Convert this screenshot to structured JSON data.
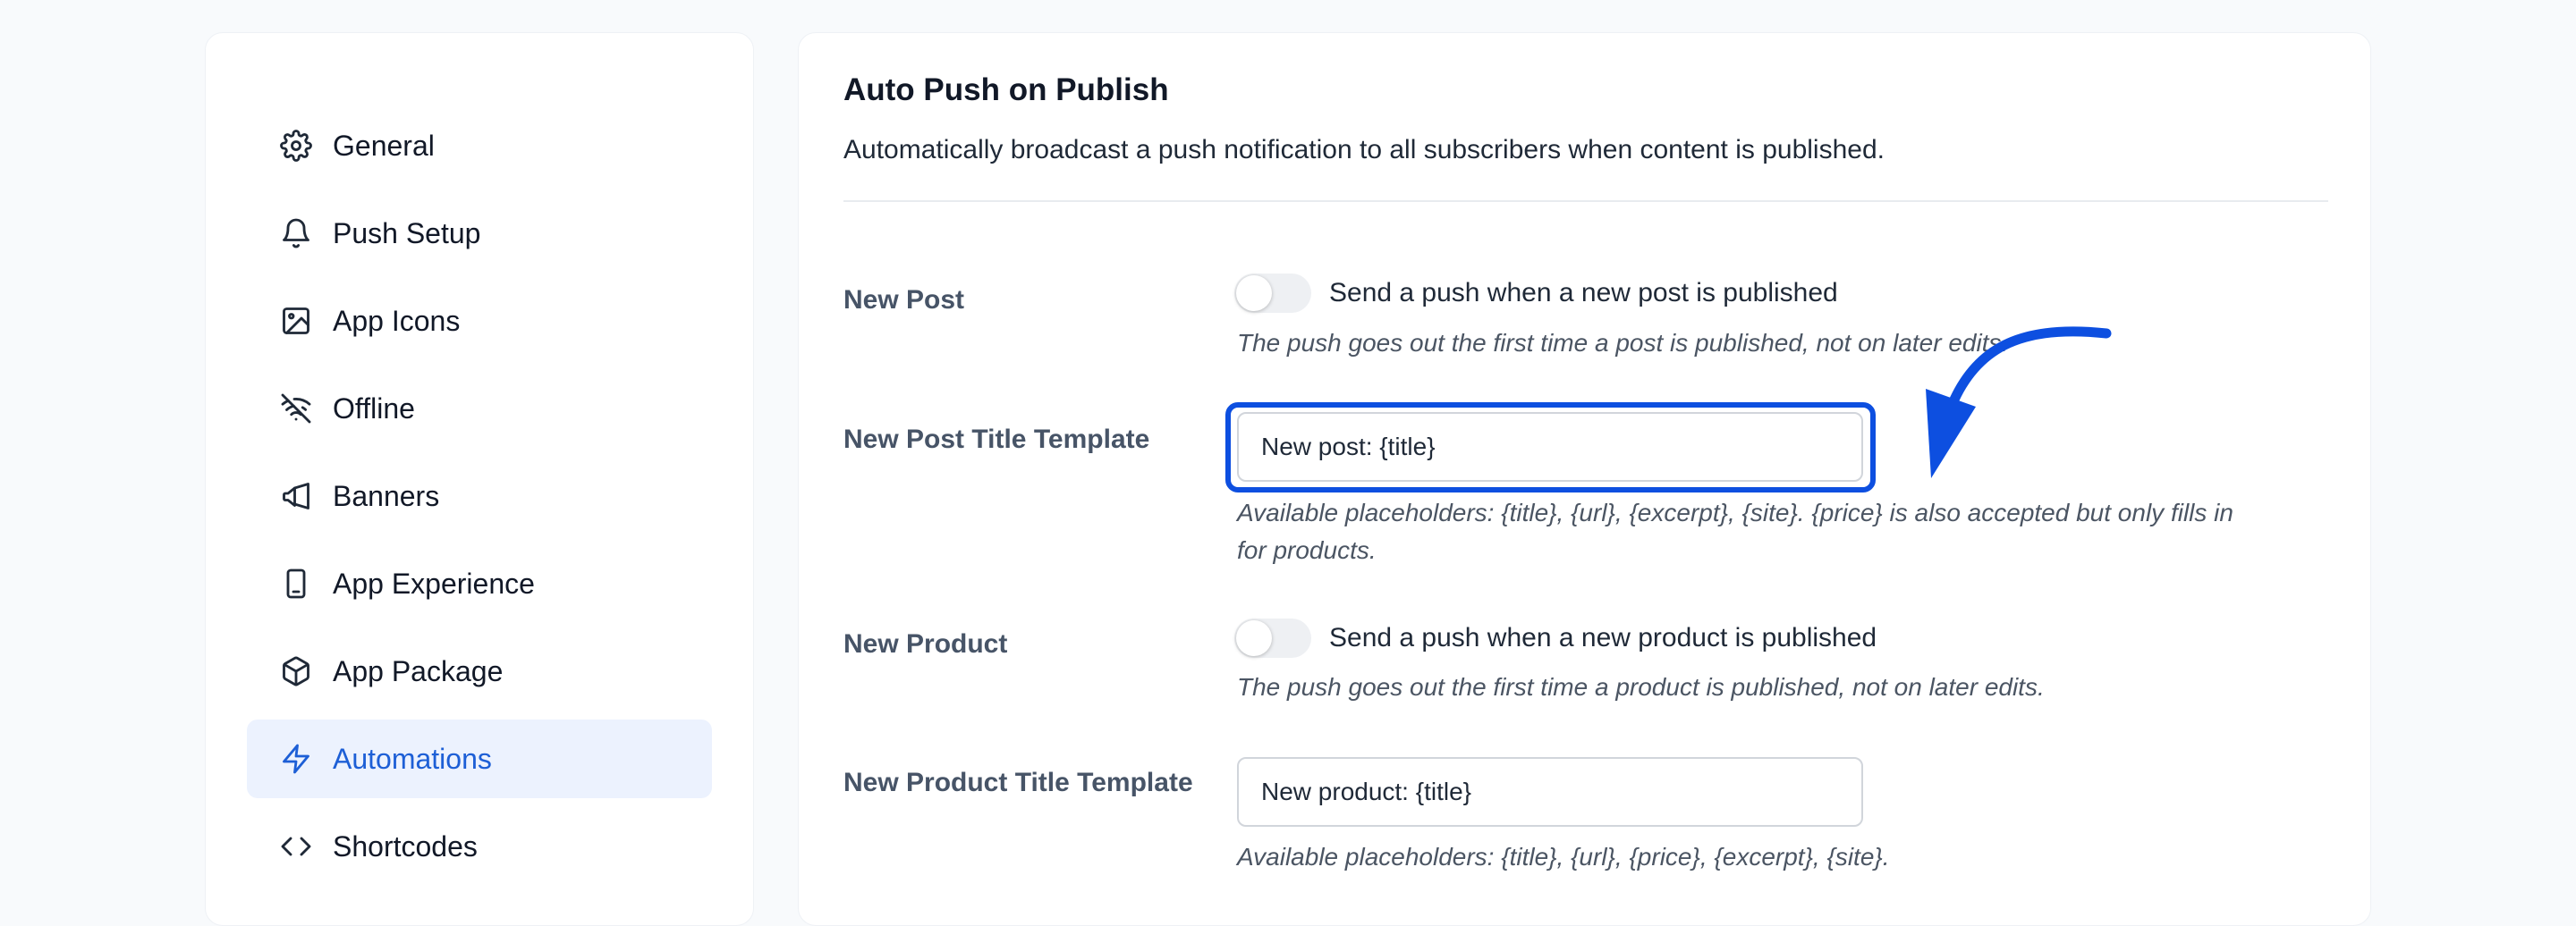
{
  "sidebar": {
    "items": [
      {
        "label": "General",
        "icon": "gear-icon"
      },
      {
        "label": "Push Setup",
        "icon": "bell-icon"
      },
      {
        "label": "App Icons",
        "icon": "image-icon"
      },
      {
        "label": "Offline",
        "icon": "wifi-off-icon"
      },
      {
        "label": "Banners",
        "icon": "megaphone-icon"
      },
      {
        "label": "App Experience",
        "icon": "phone-icon"
      },
      {
        "label": "App Package",
        "icon": "box-icon"
      },
      {
        "label": "Automations",
        "icon": "lightning-icon",
        "active": true
      },
      {
        "label": "Shortcodes",
        "icon": "code-icon"
      }
    ]
  },
  "main": {
    "title": "Auto Push on Publish",
    "description": "Automatically broadcast a push notification to all subscribers when content is published.",
    "fields": {
      "new_post": {
        "label": "New Post",
        "toggle_label": "Send a push when a new post is published",
        "toggle_on": false,
        "help": "The push goes out the first time a post is published, not on later edits."
      },
      "new_post_title": {
        "label": "New Post Title Template",
        "value": "New post: {title}",
        "help_line1": "Available placeholders: {title}, {url}, {excerpt}, {site}. {price} is also accepted but only fills in",
        "help_line2": "for products."
      },
      "new_product": {
        "label": "New Product",
        "toggle_label": "Send a push when a new product is published",
        "toggle_on": false,
        "help": "The push goes out the first time a product is published, not on later edits."
      },
      "new_product_title": {
        "label": "New Product Title Template",
        "value": "New product: {title}",
        "help": "Available placeholders: {title}, {url}, {price}, {excerpt}, {site}."
      }
    }
  },
  "colors": {
    "accent": "#1d5fd6",
    "highlight": "#0d4fe0",
    "active_bg": "#ecf2fe"
  }
}
